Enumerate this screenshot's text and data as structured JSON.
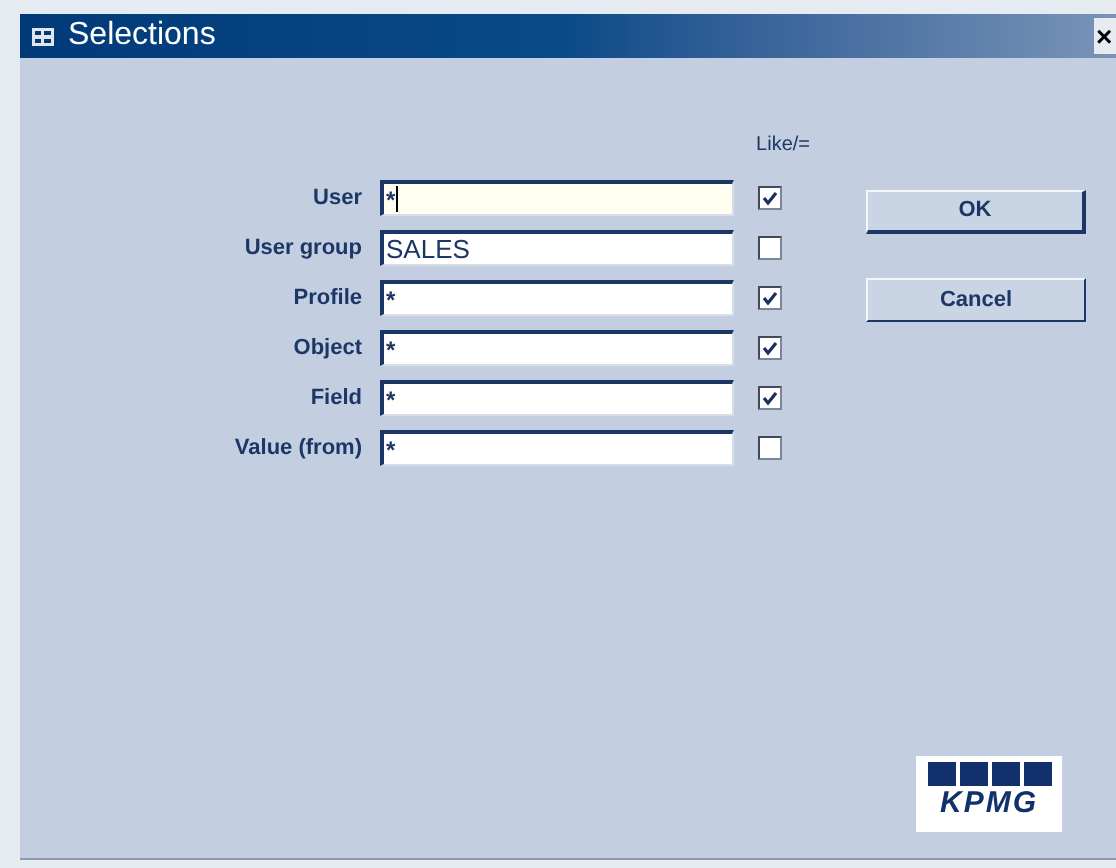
{
  "window": {
    "title": "Selections",
    "close": "×"
  },
  "column_header": "Like/=",
  "fields": [
    {
      "label": "User",
      "value": "*",
      "like": true,
      "focused": true
    },
    {
      "label": "User group",
      "value": "SALES",
      "like": false,
      "focused": false
    },
    {
      "label": "Profile",
      "value": "*",
      "like": true,
      "focused": false
    },
    {
      "label": "Object",
      "value": "*",
      "like": true,
      "focused": false
    },
    {
      "label": "Field",
      "value": "*",
      "like": true,
      "focused": false
    },
    {
      "label": "Value (from)",
      "value": "*",
      "like": false,
      "focused": false
    }
  ],
  "buttons": [
    "OK",
    "Cancel"
  ],
  "logo": {
    "text": "KPMG"
  }
}
